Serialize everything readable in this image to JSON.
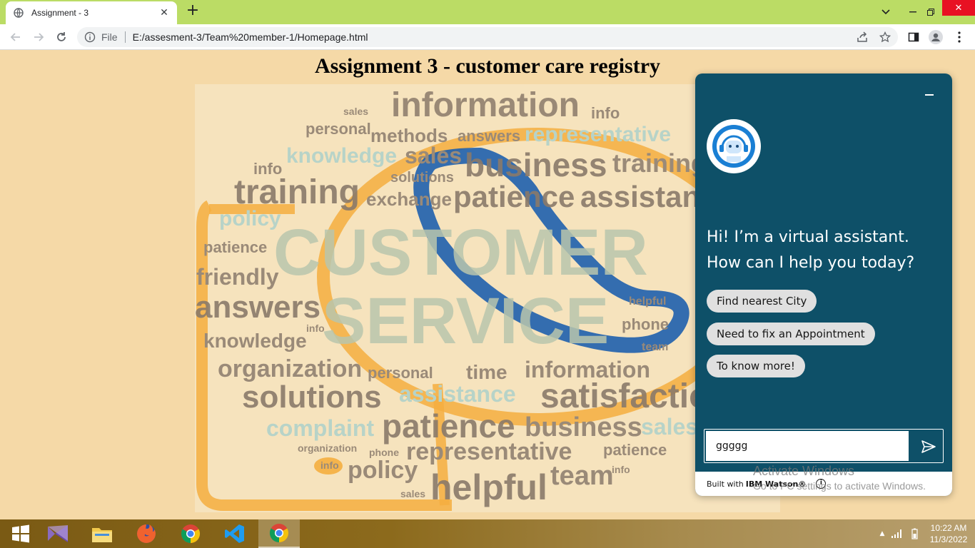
{
  "browser": {
    "tab_title": "Assignment - 3",
    "new_tab_icon": "plus-icon",
    "url_scheme_label": "File",
    "url": "E:/assesment-3/Team%20member-1/Homepage.html"
  },
  "page": {
    "title": "Assignment 3 - customer care registry"
  },
  "wordcloud": {
    "words": [
      {
        "text": "information",
        "color": "#8a7a6a"
      },
      {
        "text": "sales",
        "color": "#9a8a78"
      },
      {
        "text": "info",
        "color": "#9a8a78"
      },
      {
        "text": "personal",
        "color": "#9a8a78"
      },
      {
        "text": "methods",
        "color": "#9a8a78"
      },
      {
        "text": "answers",
        "color": "#9a8a78"
      },
      {
        "text": "representative",
        "color": "#b7d3c8"
      },
      {
        "text": "knowledge",
        "color": "#b7d3c8"
      },
      {
        "text": "business",
        "color": "#9a8a78"
      },
      {
        "text": "training",
        "color": "#9a8a78"
      },
      {
        "text": "solutions",
        "color": "#9a8a78"
      },
      {
        "text": "exchange",
        "color": "#9a8a78"
      },
      {
        "text": "patience",
        "color": "#9a8a78"
      },
      {
        "text": "assistance",
        "color": "#9a8a78"
      },
      {
        "text": "policy",
        "color": "#b7d3c8"
      },
      {
        "text": "CUSTOMER",
        "color": "#b9c6ad"
      },
      {
        "text": "SERVICE",
        "color": "#b9c6ad"
      },
      {
        "text": "friendly",
        "color": "#9a8a78"
      },
      {
        "text": "helpful",
        "color": "#9a8a78"
      },
      {
        "text": "phone",
        "color": "#9a8a78"
      },
      {
        "text": "team",
        "color": "#9a8a78"
      },
      {
        "text": "organization",
        "color": "#9a8a78"
      },
      {
        "text": "time",
        "color": "#9a8a78"
      },
      {
        "text": "satisfaction",
        "color": "#9a8a78"
      },
      {
        "text": "complaint",
        "color": "#b7d3c8"
      }
    ]
  },
  "chat": {
    "greeting": "Hi! I’m a virtual assistant. How can I help you today?",
    "options": [
      "Find nearest City",
      "Need to fix an Appointment",
      "To know more!"
    ],
    "input_value": "ggggg",
    "footer_prefix": "Built with",
    "footer_brand": "IBM Watson®",
    "minimize_icon": "minimize-icon",
    "send_icon": "send-icon",
    "accent": "#0e5068"
  },
  "watermark": {
    "line1": "Activate Windows",
    "line2": "Go to PC settings to activate Windows."
  },
  "taskbar": {
    "time": "10:22 AM",
    "date": "11/3/2022"
  }
}
